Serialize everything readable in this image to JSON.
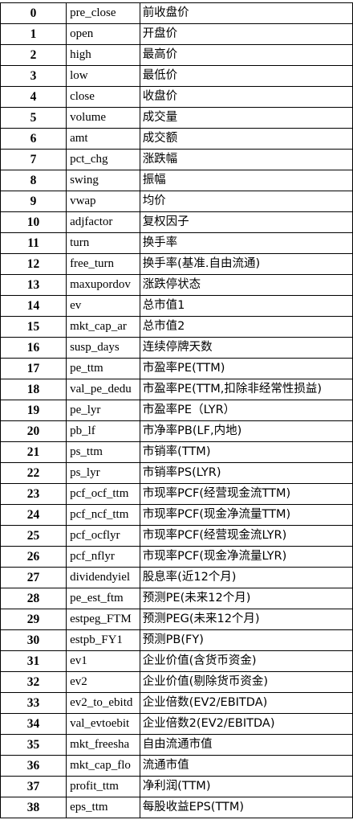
{
  "rows": [
    {
      "index": "0",
      "code": "pre_close",
      "name": "前收盘价"
    },
    {
      "index": "1",
      "code": "open",
      "name": "开盘价"
    },
    {
      "index": "2",
      "code": "high",
      "name": "最高价"
    },
    {
      "index": "3",
      "code": "low",
      "name": "最低价"
    },
    {
      "index": "4",
      "code": "close",
      "name": "收盘价"
    },
    {
      "index": "5",
      "code": "volume",
      "name": "成交量"
    },
    {
      "index": "6",
      "code": "amt",
      "name": "成交额"
    },
    {
      "index": "7",
      "code": "pct_chg",
      "name": "涨跌幅"
    },
    {
      "index": "8",
      "code": "swing",
      "name": "振幅"
    },
    {
      "index": "9",
      "code": "vwap",
      "name": "均价"
    },
    {
      "index": "10",
      "code": "adjfactor",
      "name": "复权因子"
    },
    {
      "index": "11",
      "code": "turn",
      "name": "换手率"
    },
    {
      "index": "12",
      "code": "free_turn",
      "name": "换手率(基准.自由流通)"
    },
    {
      "index": "13",
      "code": "maxupordov",
      "name": "涨跌停状态"
    },
    {
      "index": "14",
      "code": "ev",
      "name": "总市值1"
    },
    {
      "index": "15",
      "code": "mkt_cap_ar",
      "name": "总市值2"
    },
    {
      "index": "16",
      "code": "susp_days",
      "name": "连续停牌天数"
    },
    {
      "index": "17",
      "code": "pe_ttm",
      "name": "市盈率PE(TTM)"
    },
    {
      "index": "18",
      "code": "val_pe_dedu",
      "name": "市盈率PE(TTM,扣除非经常性损益)"
    },
    {
      "index": "19",
      "code": "pe_lyr",
      "name": "市盈率PE（LYR）"
    },
    {
      "index": "20",
      "code": "pb_lf",
      "name": "市净率PB(LF,内地)"
    },
    {
      "index": "21",
      "code": "ps_ttm",
      "name": "市销率(TTM)"
    },
    {
      "index": "22",
      "code": "ps_lyr",
      "name": "市销率PS(LYR)"
    },
    {
      "index": "23",
      "code": "pcf_ocf_ttm",
      "name": "市现率PCF(经营现金流TTM)"
    },
    {
      "index": "24",
      "code": "pcf_ncf_ttm",
      "name": "市现率PCF(现金净流量TTM)"
    },
    {
      "index": "25",
      "code": "pcf_ocflyr",
      "name": "市现率PCF(经营现金流LYR)"
    },
    {
      "index": "26",
      "code": "pcf_nflyr",
      "name": "市现率PCF(现金净流量LYR)"
    },
    {
      "index": "27",
      "code": "dividendyiel",
      "name": "股息率(近12个月)"
    },
    {
      "index": "28",
      "code": "pe_est_ftm",
      "name": "预测PE(未来12个月)"
    },
    {
      "index": "29",
      "code": "estpeg_FTM",
      "name": "预测PEG(未来12个月)"
    },
    {
      "index": "30",
      "code": "estpb_FY1",
      "name": "预测PB(FY)"
    },
    {
      "index": "31",
      "code": "ev1",
      "name": "企业价值(含货币资金)"
    },
    {
      "index": "32",
      "code": "ev2",
      "name": "企业价值(剔除货币资金)"
    },
    {
      "index": "33",
      "code": "ev2_to_ebitd",
      "name": "企业倍数(EV2/EBITDA)"
    },
    {
      "index": "34",
      "code": "val_evtoebit",
      "name": "企业倍数2(EV2/EBITDA)"
    },
    {
      "index": "35",
      "code": "mkt_freesha",
      "name": "自由流通市值"
    },
    {
      "index": "36",
      "code": "mkt_cap_flo",
      "name": "流通市值"
    },
    {
      "index": "37",
      "code": "profit_ttm",
      "name": "净利润(TTM)"
    },
    {
      "index": "38",
      "code": "eps_ttm",
      "name": "每股收益EPS(TTM)"
    }
  ]
}
